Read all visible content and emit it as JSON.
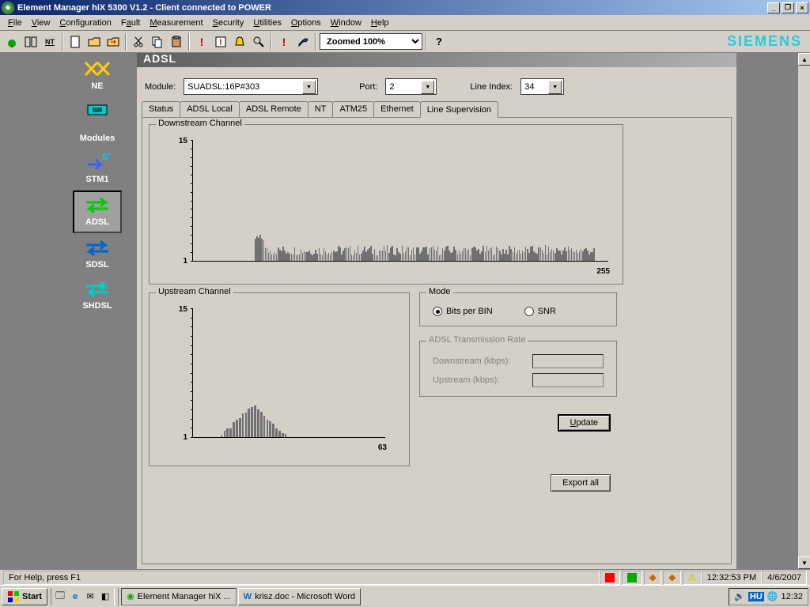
{
  "title_bar": {
    "text": "Element Manager hiX 5300 V1.2 - Client connected to POWER"
  },
  "menus": [
    "File",
    "View",
    "Configuration",
    "Fault",
    "Measurement",
    "Security",
    "Utilities",
    "Options",
    "Window",
    "Help"
  ],
  "toolbar": {
    "zoom": "Zoomed 100%",
    "brand": "SIEMENS"
  },
  "sidebar": {
    "top": "NE",
    "section": "Modules",
    "items": [
      {
        "label": "STM1"
      },
      {
        "label": "ADSL"
      },
      {
        "label": "SDSL"
      },
      {
        "label": "SHDSL"
      }
    ],
    "selected": "ADSL"
  },
  "content": {
    "title": "ADSL",
    "module_label": "Module:",
    "module_value": "SUADSL:16P#303",
    "port_label": "Port:",
    "port_value": "2",
    "lineindex_label": "Line Index:",
    "lineindex_value": "34",
    "tabs": [
      "Status",
      "ADSL Local",
      "ADSL Remote",
      "NT",
      "ATM25",
      "Ethernet",
      "Line Supervision"
    ],
    "active_tab": "Line Supervision",
    "downstream_title": "Downstream Channel",
    "upstream_title": "Upstream Channel",
    "mode_title": "Mode",
    "mode_bits": "Bits per BIN",
    "mode_snr": "SNR",
    "rate_title": "ADSL Transmission Rate",
    "rate_down": "Downstream (kbps):",
    "rate_up": "Upstream (kbps):",
    "update_btn": "Update",
    "export_btn": "Export all"
  },
  "status": {
    "help": "For Help, press F1",
    "time": "12:32:53 PM",
    "date": "4/6/2007"
  },
  "taskbar": {
    "start": "Start",
    "task1": "Element Manager hiX ...",
    "task2": "krisz.doc - Microsoft Word",
    "lang": "HU",
    "clock": "12:32"
  },
  "chart_data": [
    {
      "type": "bar",
      "title": "Downstream Channel",
      "xlabel": "",
      "ylabel": "",
      "ylim": [
        1,
        15
      ],
      "xmax": 255,
      "bars_start": 38,
      "bars_end": 246,
      "peak_value": 4,
      "typical_value": 2.2
    },
    {
      "type": "bar",
      "title": "Upstream Channel",
      "xlabel": "",
      "ylabel": "",
      "ylim": [
        1,
        15
      ],
      "xmax": 63,
      "bars_start": 8,
      "bars_end": 31,
      "peak_value": 4.3,
      "typical_value": 2
    }
  ]
}
